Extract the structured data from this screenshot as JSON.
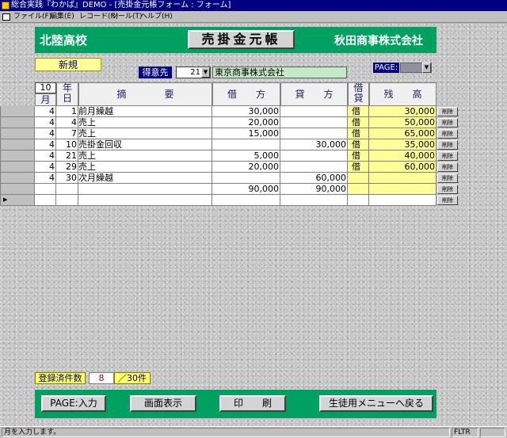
{
  "window": {
    "title": "総合実践『わかば』DEMO - [売掛金元帳フォーム : フォーム]"
  },
  "menu": {
    "items": [
      "ファイル(F)",
      "編集(E)",
      "レコード(R)",
      "ツール(T)",
      "ヘルプ(H)"
    ]
  },
  "header": {
    "school": "北陸高校",
    "ledger_title": "売掛金元帳",
    "company": "秋田商事株式会社"
  },
  "form": {
    "mode_badge": "新規",
    "customer_label": "得意先",
    "customer_no": "21",
    "customer_name": "東京商事株式会社",
    "page_label": "PAGE:",
    "month_value": "10",
    "month_label": "月"
  },
  "columns": {
    "day": "年\n日",
    "desc": "摘　　　　要",
    "debit": "借　　方",
    "credit": "貸　　方",
    "dc": "借\n貸",
    "balance": "残　　高"
  },
  "rows": [
    {
      "m": "4",
      "d": "1",
      "desc": "前月繰越",
      "debit": "30,000",
      "credit": "",
      "dc": "借",
      "bal": "30,000"
    },
    {
      "m": "4",
      "d": "4",
      "desc": "売上",
      "debit": "20,000",
      "credit": "",
      "dc": "借",
      "bal": "50,000"
    },
    {
      "m": "4",
      "d": "7",
      "desc": "売上",
      "debit": "15,000",
      "credit": "",
      "dc": "借",
      "bal": "65,000"
    },
    {
      "m": "4",
      "d": "10",
      "desc": "売掛金回収",
      "debit": "",
      "credit": "30,000",
      "dc": "借",
      "bal": "35,000"
    },
    {
      "m": "4",
      "d": "21",
      "desc": "売上",
      "debit": "5,000",
      "credit": "",
      "dc": "借",
      "bal": "40,000"
    },
    {
      "m": "4",
      "d": "29",
      "desc": "売上",
      "debit": "20,000",
      "credit": "",
      "dc": "借",
      "bal": "60,000"
    },
    {
      "m": "4",
      "d": "30",
      "desc": "次月繰越",
      "debit": "",
      "credit": "60,000",
      "dc": "",
      "bal": ""
    },
    {
      "m": "",
      "d": "",
      "desc": "",
      "debit": "90,000",
      "credit": "90,000",
      "dc": "",
      "bal": ""
    },
    {
      "m": "",
      "d": "",
      "desc": "",
      "debit": "",
      "credit": "",
      "dc": "",
      "bal": ""
    }
  ],
  "delete_label": "削除",
  "footer": {
    "reg_label": "登録済件数",
    "reg_count": "8",
    "reg_max": "／30件"
  },
  "buttons": {
    "page_input": "PAGE:入力",
    "screen_display": "画面表示",
    "print": "印　　刷",
    "back_menu": "生徒用メニューへ戻る"
  },
  "status": {
    "message": "月を入力します。",
    "fltr": "FLTR"
  },
  "colors": {
    "green": "#00a060",
    "yellow": "#ffff99",
    "navy": "#000080"
  }
}
